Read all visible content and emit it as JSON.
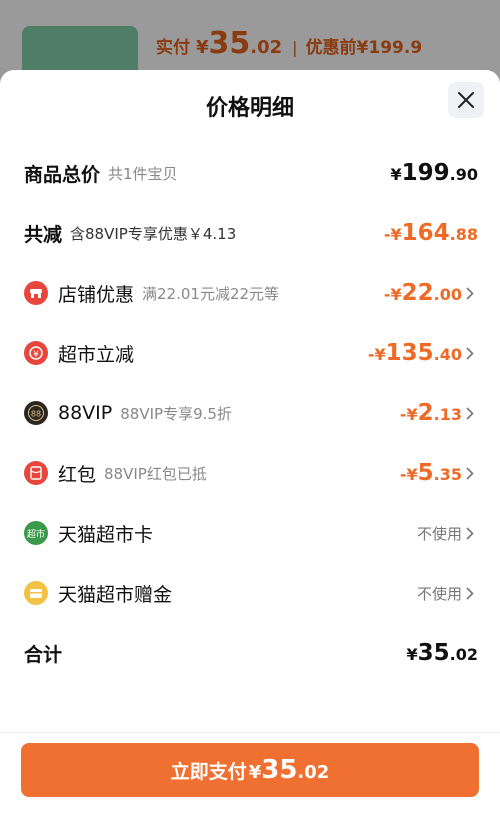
{
  "background": {
    "pay_label": "实付",
    "currency": "¥",
    "price_int": "35",
    "price_dec": ".02",
    "separator": "|",
    "original_label": "优惠前¥199.9"
  },
  "sheet": {
    "title": "价格明细"
  },
  "rows": {
    "total": {
      "label": "商品总价",
      "sub": "共1件宝贝",
      "sign": "",
      "yen": "¥",
      "int": "199",
      "dec": ".90"
    },
    "reduce": {
      "label": "共减",
      "sub": "含88VIP专享优惠￥4.13",
      "sign": "-",
      "yen": "¥",
      "int": "164",
      "dec": ".88"
    },
    "store": {
      "label": "店铺优惠",
      "sub": "满22.01元减22元等",
      "sign": "-",
      "yen": "¥",
      "int": "22",
      "dec": ".00",
      "icon": "store-icon",
      "color": "#e8453c"
    },
    "market": {
      "label": "超市立减",
      "sub": "",
      "sign": "-",
      "yen": "¥",
      "int": "135",
      "dec": ".40",
      "icon": "discount-icon",
      "color": "#e8453c"
    },
    "vip": {
      "label": "88VIP",
      "sub": "88VIP专享9.5折",
      "sign": "-",
      "yen": "¥",
      "int": "2",
      "dec": ".13",
      "icon": "88vip-icon",
      "color": "#2b2620"
    },
    "redpacket": {
      "label": "红包",
      "sub": "88VIP红包已抵",
      "sign": "-",
      "yen": "¥",
      "int": "5",
      "dec": ".35",
      "icon": "red-packet-icon",
      "color": "#e8453c"
    },
    "card": {
      "label": "天猫超市卡",
      "value": "不使用",
      "icon": "supermarket-card-icon",
      "icon_text": "超市",
      "color": "#3a9a4a"
    },
    "gift": {
      "label": "天猫超市赠金",
      "value": "不使用",
      "icon": "gift-money-icon",
      "color": "#f3c244"
    },
    "sum": {
      "label": "合计",
      "yen": "¥",
      "int": "35",
      "dec": ".02"
    }
  },
  "footer": {
    "pay_text": "立即支付",
    "yen": "¥",
    "int": "35",
    "dec": ".02"
  },
  "colors": {
    "accent": "#ef7030",
    "discount": "#ef6a27"
  }
}
